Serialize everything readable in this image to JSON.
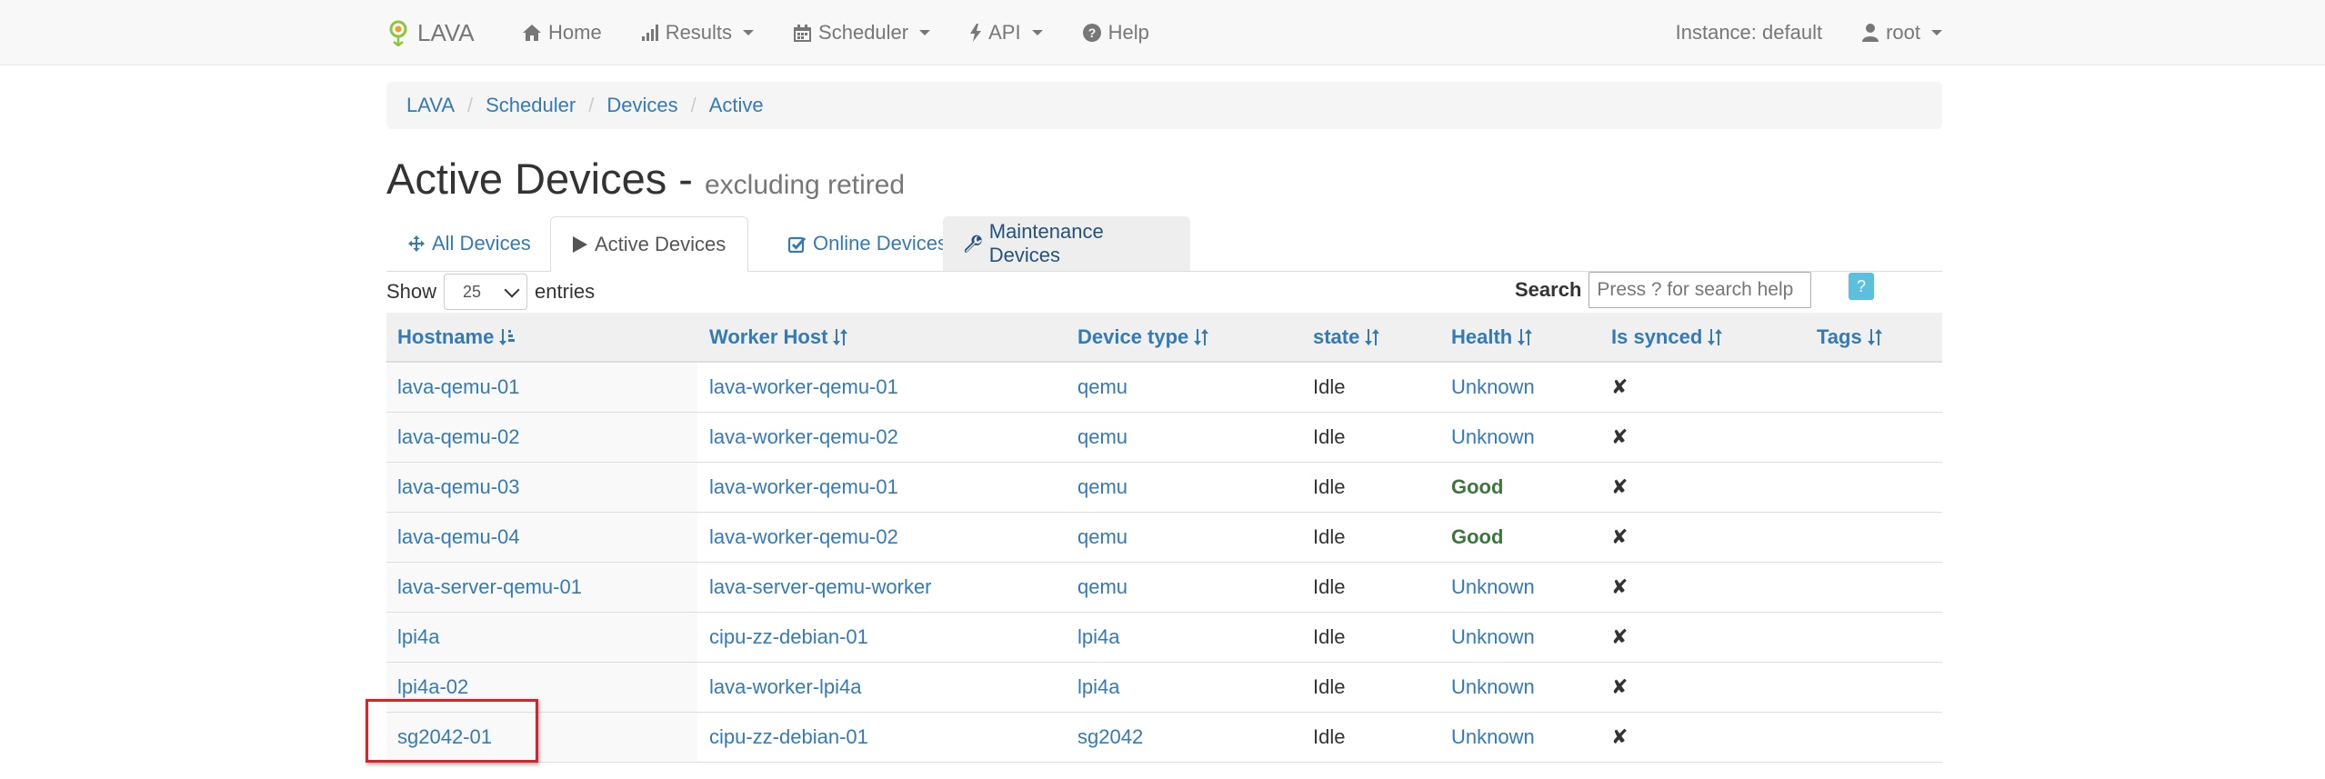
{
  "navbar": {
    "brand": "LAVA",
    "items": [
      {
        "label": "Home",
        "icon": "home-icon",
        "dropdown": false
      },
      {
        "label": "Results",
        "icon": "signal-icon",
        "dropdown": true
      },
      {
        "label": "Scheduler",
        "icon": "calendar-icon",
        "dropdown": true
      },
      {
        "label": "API",
        "icon": "flash-icon",
        "dropdown": true
      },
      {
        "label": "Help",
        "icon": "question-circle-icon",
        "dropdown": false
      }
    ],
    "instance": "Instance: default",
    "user": "root"
  },
  "breadcrumb": [
    "LAVA",
    "Scheduler",
    "Devices",
    "Active"
  ],
  "heading": {
    "title": "Active Devices -",
    "subtitle": "excluding retired"
  },
  "tabs": [
    {
      "label": "All Devices",
      "icon": "move-icon"
    },
    {
      "label": "Active Devices",
      "icon": "play-icon"
    },
    {
      "label": "Online Devices",
      "icon": "check-icon"
    },
    {
      "label": "Maintenance Devices",
      "icon": "wrench-icon"
    }
  ],
  "controls": {
    "show_label": "Show",
    "entries_value": "25",
    "entries_label": "entries",
    "search_label": "Search",
    "search_placeholder": "Press ? for search help",
    "help_label": "?"
  },
  "table": {
    "headers": [
      "Hostname",
      "Worker Host",
      "Device type",
      "state",
      "Health",
      "Is synced",
      "Tags"
    ],
    "rows": [
      {
        "hostname": "lava-qemu-01",
        "worker": "lava-worker-qemu-01",
        "device_type": "qemu",
        "state": "Idle",
        "health": "Unknown",
        "synced": "✘",
        "tags": ""
      },
      {
        "hostname": "lava-qemu-02",
        "worker": "lava-worker-qemu-02",
        "device_type": "qemu",
        "state": "Idle",
        "health": "Unknown",
        "synced": "✘",
        "tags": ""
      },
      {
        "hostname": "lava-qemu-03",
        "worker": "lava-worker-qemu-01",
        "device_type": "qemu",
        "state": "Idle",
        "health": "Good",
        "synced": "✘",
        "tags": ""
      },
      {
        "hostname": "lava-qemu-04",
        "worker": "lava-worker-qemu-02",
        "device_type": "qemu",
        "state": "Idle",
        "health": "Good",
        "synced": "✘",
        "tags": ""
      },
      {
        "hostname": "lava-server-qemu-01",
        "worker": "lava-server-qemu-worker",
        "device_type": "qemu",
        "state": "Idle",
        "health": "Unknown",
        "synced": "✘",
        "tags": ""
      },
      {
        "hostname": "lpi4a",
        "worker": "cipu-zz-debian-01",
        "device_type": "lpi4a",
        "state": "Idle",
        "health": "Unknown",
        "synced": "✘",
        "tags": ""
      },
      {
        "hostname": "lpi4a-02",
        "worker": "lava-worker-lpi4a",
        "device_type": "lpi4a",
        "state": "Idle",
        "health": "Unknown",
        "synced": "✘",
        "tags": ""
      },
      {
        "hostname": "sg2042-01",
        "worker": "cipu-zz-debian-01",
        "device_type": "sg2042",
        "state": "Idle",
        "health": "Unknown",
        "synced": "✘",
        "tags": ""
      }
    ]
  },
  "colors": {
    "link": "#337ab7",
    "good": "#3c763d",
    "highlight": "#d9232a",
    "help_button": "#5bc0de"
  }
}
